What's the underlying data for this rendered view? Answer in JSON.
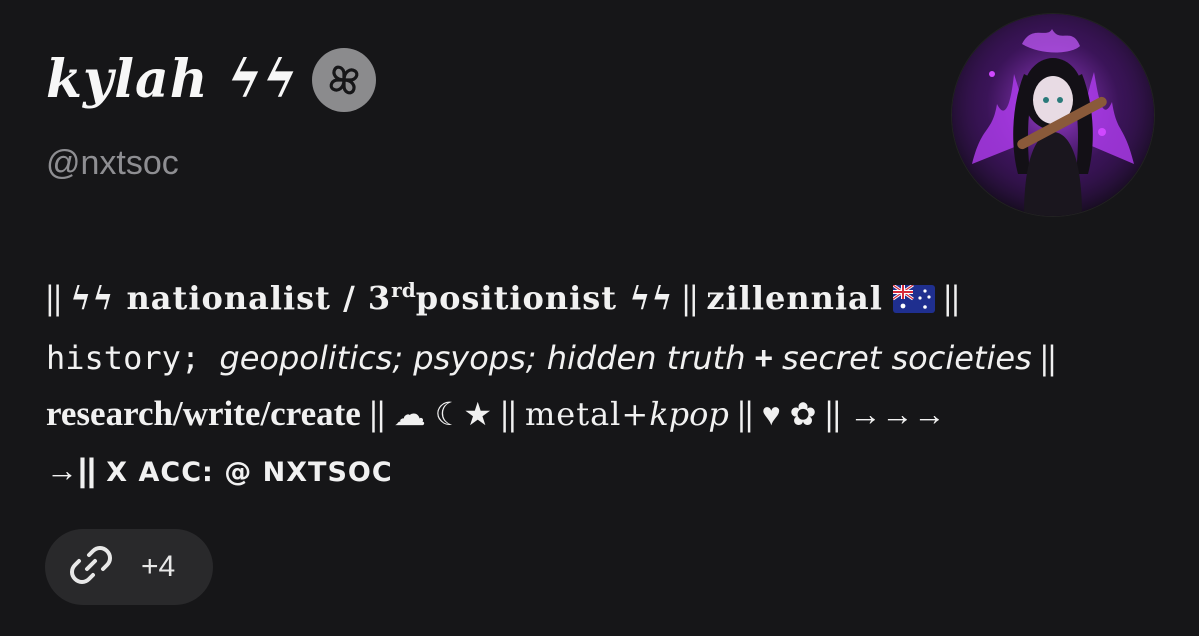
{
  "profile": {
    "display_name": "kylah ϟϟ",
    "badge_icon": "pinwheel-badge-icon",
    "handle": "@nxtsoc",
    "avatar_icon": "anime-girl-purple-flames-avatar"
  },
  "bio": {
    "l1_sep1": "|| ",
    "l1_bolts1": "ϟϟ ",
    "l1_nationalist": "nationalist",
    "l1_slash": " / 3",
    "l1_rd": "rd",
    "l1_positionist": "positionist",
    "l1_bolts2": " ϟϟ",
    "l1_sep2": " || ",
    "l1_zillennial": "zillennial",
    "l1_sep3": " ||",
    "l2_history": "history; ",
    "l2_geopolitics": "geopolitics;",
    "l2_psyops": "psyops;",
    "l2_hidden": "hidden truth",
    "l2_plus": " + ",
    "l2_secret": "secret societies",
    "l2_sep": " ||",
    "l3_research": "research/write/create",
    "l3_sep1": " || ",
    "l3_symbols": "☁ ☾★",
    "l3_sep2": " || ",
    "l3_metal": "metal+",
    "l3_kpop": "kpop",
    "l3_sep3": " || ",
    "l3_heart_flower": "♥ ✿",
    "l3_sep4": " || ",
    "l3_arrows": "→→→",
    "l4_arrow": "→||",
    "l4_xacc": " X ACC: @ NXTSOC"
  },
  "links": {
    "link_icon": "link-icon",
    "count": "+4"
  },
  "colors": {
    "background": "#161618",
    "text": "#f1f1f1",
    "handle": "#8e8e92",
    "badge": "#8b8b8d",
    "pill": "#29292b",
    "accent_purple": "#9b3bdc"
  }
}
